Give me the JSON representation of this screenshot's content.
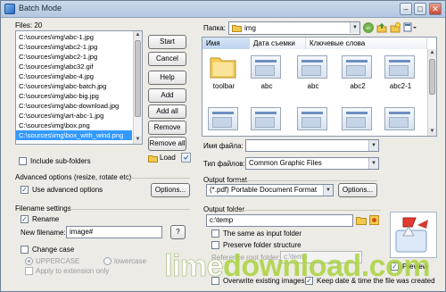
{
  "window": {
    "title": "Batch Mode"
  },
  "files": {
    "label": "Files: 20",
    "items": [
      "C:\\sources\\img\\abc-1.jpg",
      "C:\\sources\\img\\abc2-1.jpg",
      "C:\\sources\\img\\abc2-1.jpg",
      "C:\\sources\\img\\abc32.gif",
      "C:\\sources\\img\\abc-4.jpg",
      "C:\\sources\\img\\abc-batch.jpg",
      "C:\\sources\\img\\abc-big.jpg",
      "C:\\sources\\img\\abc-download.jpg",
      "C:\\sources\\img\\art-abc-1.jpg",
      "C:\\sources\\img\\box.png",
      "C:\\sources\\img\\box_with_wind.png"
    ],
    "selected_index": 10,
    "include_subfolders": "Include sub-folders"
  },
  "actions": {
    "start": "Start",
    "cancel": "Cancel",
    "help": "Help",
    "add": "Add",
    "add_all": "Add all",
    "remove": "Remove",
    "remove_all": "Remove all",
    "load": "Load"
  },
  "advanced": {
    "section": "Advanced options (resize, rotate etc)",
    "use_label": "Use advanced options",
    "options_button": "Options..."
  },
  "filename_settings": {
    "section": "Filename settings",
    "rename_label": "Rename",
    "new_filename_label": "New filename:",
    "new_filename_value": "image#",
    "help_button": "?",
    "change_case_label": "Change case",
    "uppercase_label": "UPPERCASE",
    "lowercase_label": "lowercase",
    "ext_only_label": "Apply to extension only"
  },
  "browser": {
    "folder_label": "Папка:",
    "folder_value": "img",
    "columns": [
      "Имя",
      "Дата съемки",
      "Ключевые слова"
    ],
    "items": [
      "toolbar",
      "abc",
      "abc",
      "abc2",
      "abc2-1"
    ],
    "filename_label": "Имя файла:",
    "filetype_label": "Тип файлов:",
    "filetype_value": "Common Graphic Files"
  },
  "output_format": {
    "section": "Output format",
    "value": "(*.pdf) Portable Document Format",
    "options_button": "Options..."
  },
  "output_folder": {
    "section": "Output folder",
    "path": "c:\\temp",
    "same_as_input": "The same as input folder",
    "preserve_structure": "Preserve folder structure",
    "reference_root_label": "Reference root folder:",
    "reference_root_value": "c:\\temp",
    "overwrite": "Overwrite existing images",
    "keep_date": "Keep date & time the file was created"
  },
  "preview": {
    "label": "Preview"
  },
  "watermark": {
    "text_a": "lime",
    "text_b": "download.com"
  }
}
